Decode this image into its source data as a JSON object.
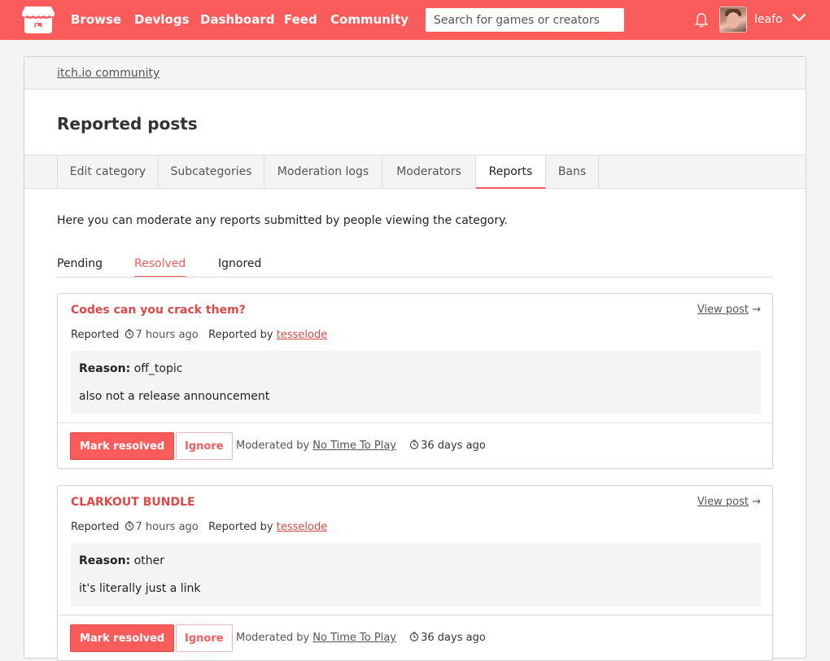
{
  "header": {
    "nav": [
      "Browse",
      "Devlogs",
      "Dashboard",
      "Feed",
      "Community"
    ],
    "search_placeholder": "Search for games or creators",
    "username": "leafo"
  },
  "breadcrumb": "itch.io community",
  "page_title": "Reported posts",
  "tabs": [
    "Edit category",
    "Subcategories",
    "Moderation logs",
    "Moderators",
    "Reports",
    "Bans"
  ],
  "active_tab": "Reports",
  "intro": "Here you can moderate any reports submitted by people viewing the category.",
  "subtabs": [
    "Pending",
    "Resolved",
    "Ignored"
  ],
  "active_subtab": "Resolved",
  "labels": {
    "view_post": "View post",
    "arrow": "→",
    "reported": "Reported",
    "reported_by": "Reported by",
    "reason": "Reason:",
    "mark_resolved": "Mark resolved",
    "ignore": "Ignore",
    "moderated_by": "Moderated by"
  },
  "reports": [
    {
      "title": "Codes can you crack them?",
      "reported_ago": "7 hours ago",
      "reporter": "tesselode",
      "reason": "off_topic",
      "note": "also not a release announcement",
      "moderator": "No Time To Play",
      "moderated_ago": "36 days ago"
    },
    {
      "title": "CLARKOUT BUNDLE",
      "reported_ago": "7 hours ago",
      "reporter": "tesselode",
      "reason": "other",
      "note": "it's literally just a link",
      "moderator": "No Time To Play",
      "moderated_ago": "36 days ago"
    }
  ],
  "colors": {
    "brand": "#fa5c5c",
    "link_red": "#da4a4a"
  }
}
